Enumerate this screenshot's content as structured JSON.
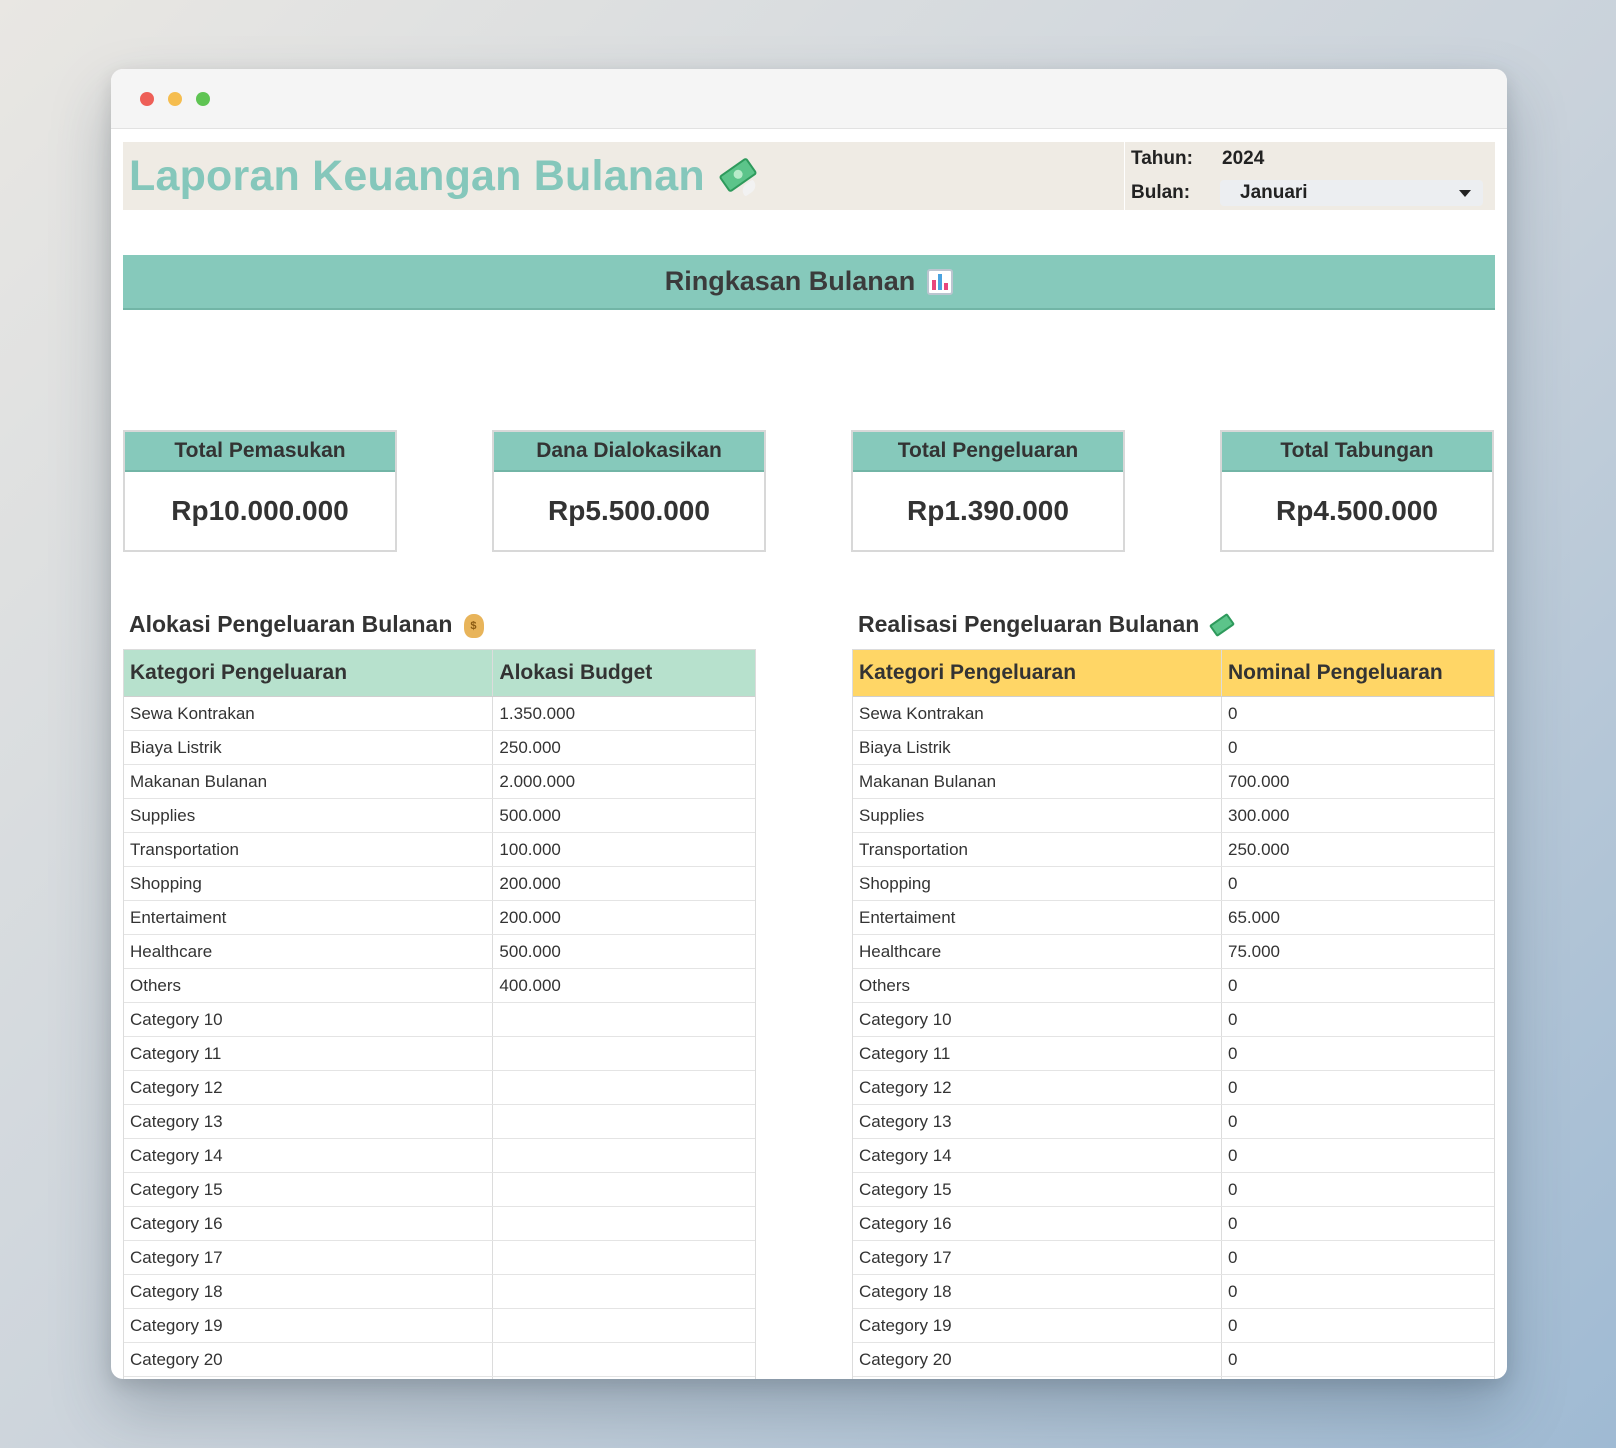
{
  "header": {
    "title": "Laporan Keuangan Bulanan",
    "year_label": "Tahun:",
    "year_value": "2024",
    "month_label": "Bulan:",
    "month_value": "Januari"
  },
  "banner": {
    "title": "Ringkasan Bulanan"
  },
  "cards": [
    {
      "label": "Total Pemasukan",
      "value": "Rp10.000.000"
    },
    {
      "label": "Dana Dialokasikan",
      "value": "Rp5.500.000"
    },
    {
      "label": "Total Pengeluaran",
      "value": "Rp1.390.000"
    },
    {
      "label": "Total Tabungan",
      "value": "Rp4.500.000"
    }
  ],
  "allocation": {
    "title": "Alokasi Pengeluaran Bulanan",
    "col1": "Kategori Pengeluaran",
    "col2": "Alokasi Budget",
    "rows": [
      [
        "Sewa Kontrakan",
        "1.350.000"
      ],
      [
        "Biaya Listrik",
        "250.000"
      ],
      [
        "Makanan Bulanan",
        "2.000.000"
      ],
      [
        "Supplies",
        "500.000"
      ],
      [
        "Transportation",
        "100.000"
      ],
      [
        "Shopping",
        "200.000"
      ],
      [
        "Entertaiment",
        "200.000"
      ],
      [
        "Healthcare",
        "500.000"
      ],
      [
        "Others",
        "400.000"
      ],
      [
        "Category 10",
        ""
      ],
      [
        "Category 11",
        ""
      ],
      [
        "Category 12",
        ""
      ],
      [
        "Category 13",
        ""
      ],
      [
        "Category 14",
        ""
      ],
      [
        "Category 15",
        ""
      ],
      [
        "Category 16",
        ""
      ],
      [
        "Category 17",
        ""
      ],
      [
        "Category 18",
        ""
      ],
      [
        "Category 19",
        ""
      ],
      [
        "Category 20",
        ""
      ],
      [
        "",
        ""
      ]
    ]
  },
  "realization": {
    "title": "Realisasi Pengeluaran Bulanan",
    "col1": "Kategori Pengeluaran",
    "col2": "Nominal Pengeluaran",
    "rows": [
      [
        "Sewa Kontrakan",
        "0"
      ],
      [
        "Biaya Listrik",
        "0"
      ],
      [
        "Makanan Bulanan",
        "700.000"
      ],
      [
        "Supplies",
        "300.000"
      ],
      [
        "Transportation",
        "250.000"
      ],
      [
        "Shopping",
        "0"
      ],
      [
        "Entertaiment",
        "65.000"
      ],
      [
        "Healthcare",
        "75.000"
      ],
      [
        "Others",
        "0"
      ],
      [
        "Category 10",
        "0"
      ],
      [
        "Category 11",
        "0"
      ],
      [
        "Category 12",
        "0"
      ],
      [
        "Category 13",
        "0"
      ],
      [
        "Category 14",
        "0"
      ],
      [
        "Category 15",
        "0"
      ],
      [
        "Category 16",
        "0"
      ],
      [
        "Category 17",
        "0"
      ],
      [
        "Category 18",
        "0"
      ],
      [
        "Category 19",
        "0"
      ],
      [
        "Category 20",
        "0"
      ],
      [
        "",
        ""
      ]
    ]
  },
  "colors": {
    "title_teal": "#85c7bb",
    "banner_teal": "#86c9bb",
    "header_bg": "#efebe4",
    "alloc_header": "#b7e1cd",
    "real_header": "#ffd666"
  },
  "icons": {
    "title_icon": "money-with-wings-icon",
    "banner_icon": "bar-chart-icon",
    "allocation_icon": "money-bag-icon",
    "realization_icon": "money-with-wings-icon"
  }
}
